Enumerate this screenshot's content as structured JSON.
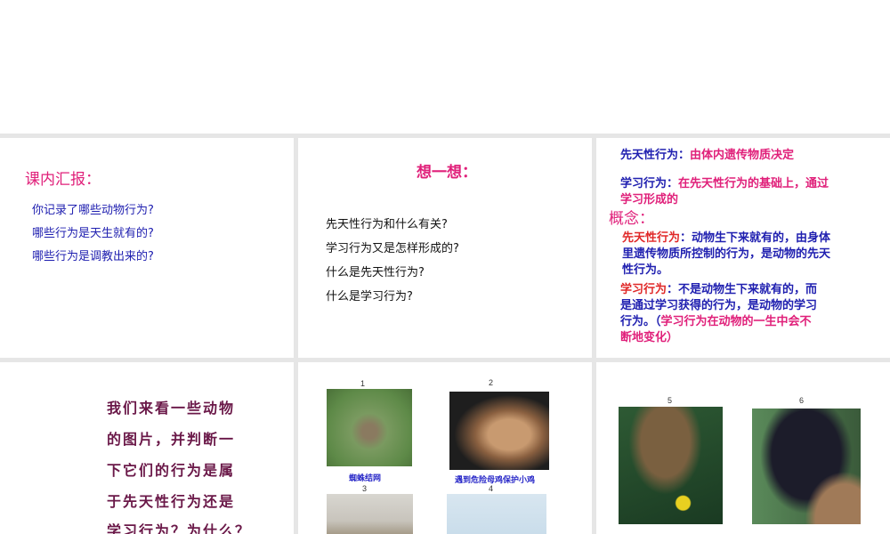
{
  "slides": [
    {
      "title": "课内汇报：",
      "lines": [
        "你记录了哪些动物行为?",
        "哪些行为是天生就有的?",
        "哪些行为是调教出来的?"
      ]
    },
    {
      "title": "想一想：",
      "lines": [
        "先天性行为和什么有关?",
        "学习行为又是怎样形成的?",
        "什么是先天性行为?",
        "什么是学习行为?"
      ]
    },
    {
      "innate_label": "先天性行为：",
      "innate_text": "由体内遗传物质决定",
      "learned_label": "学习行为：",
      "learned_text_1": "在先天性行为的基础上，通过",
      "learned_text_2": "学习形成的",
      "concept_title": "概念：",
      "def1_label": "先天性行为",
      "def1_line1": "：动物生下来就有的，由身体",
      "def1_line2": "里遗传物质所控制的行为，是动物的先天",
      "def1_line3": "性行为。",
      "def2_label": "学习行为",
      "def2_line1": "：不是动物生下来就有的，而",
      "def2_line2": "是通过学习获得的行为，是动物的学习",
      "def2_line3a": "行为。（",
      "def2_line3b": "学习行为在动物的一生中会不",
      "def2_line4": "断地变化）"
    },
    {
      "lines": [
        "我们来看一些动物",
        "的图片，并判断一",
        "下它们的行为是属",
        "于先天性行为还是",
        "学习行为？为什么？"
      ]
    },
    {
      "images": [
        {
          "number": "1",
          "caption": "蜘蛛结网"
        },
        {
          "number": "2",
          "caption": "遇到危险母鸡保护小鸡"
        },
        {
          "number": "3"
        },
        {
          "number": "4"
        }
      ]
    },
    {
      "images": [
        {
          "number": "5"
        },
        {
          "number": "6"
        }
      ]
    }
  ]
}
